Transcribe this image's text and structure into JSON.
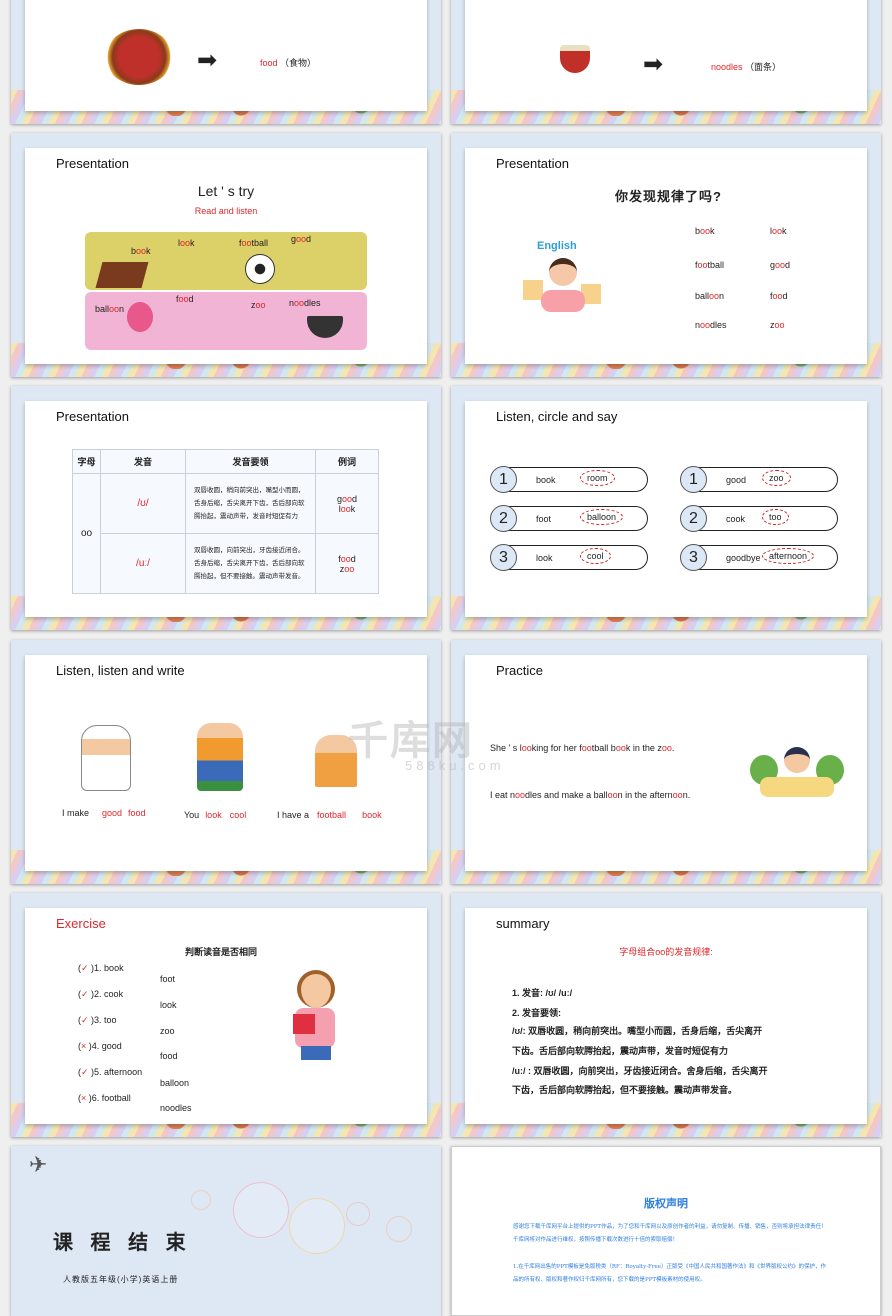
{
  "slide_food": {
    "word": "food",
    "cn": "（食物）",
    "image": "hotpot-image"
  },
  "slide_noodles": {
    "word": "noodles",
    "cn": "（面条）",
    "image": "noodle-bowl-image"
  },
  "slide_letstry": {
    "heading": "Presentation",
    "title": "Let ' s try",
    "subtitle": "Read and listen",
    "labels": [
      "book",
      "look",
      "football",
      "good",
      "balloon",
      "food",
      "zoo",
      "noodles"
    ]
  },
  "slide_rule": {
    "heading": "Presentation",
    "title": "你发现规律了吗?",
    "col1": [
      "book",
      "football",
      "balloon",
      "noodles"
    ],
    "col2": [
      "look",
      "good",
      "food",
      "zoo"
    ],
    "image_label": "English"
  },
  "slide_table": {
    "heading": "Presentation",
    "headers": [
      "字母",
      "发音",
      "发音要领",
      "例词"
    ],
    "letter": "oo",
    "rows": [
      {
        "sound": "/ʊ/",
        "tip": "双唇收圆，稍向前突出，嘴型小而圆，舌身后缩，舌尖离开下齿，舌后部向软腭抬起，震动声带，发音时短促有力",
        "ex1": "good",
        "ex2": "look"
      },
      {
        "sound": "/uː/",
        "tip": "双唇收圆，向前突出，牙齿接近闭合。舌身后缩，舌尖离开下齿，舌后部向软腭抬起，但不要接触。震动声带发音。",
        "ex1": "food",
        "ex2": "zoo"
      }
    ]
  },
  "slide_circle": {
    "heading": "Listen, circle and say",
    "left": [
      {
        "n": "1",
        "a": "book",
        "b": "room"
      },
      {
        "n": "2",
        "a": "foot",
        "b": "balloon"
      },
      {
        "n": "3",
        "a": "look",
        "b": "cool"
      }
    ],
    "right": [
      {
        "n": "1",
        "a": "good",
        "b": "zoo"
      },
      {
        "n": "2",
        "a": "cook",
        "b": "too"
      },
      {
        "n": "3",
        "a": "goodbye",
        "b": "afternoon"
      }
    ]
  },
  "slide_write": {
    "heading": "Listen, listen and write",
    "s1": {
      "pre": "I make",
      "a": "good",
      "b": "food"
    },
    "s2": {
      "pre": "You",
      "a": "look",
      "b": "cool"
    },
    "s3": {
      "pre": "I have a",
      "a": "football",
      "b": "book"
    }
  },
  "slide_practice": {
    "heading": "Practice",
    "s1": "She ' s looking for her football book in the zoo.",
    "s2": "I eat noodles and make a balloon in the afternoon."
  },
  "slide_exercise": {
    "heading": "Exercise",
    "title": "判断读音是否相同",
    "items": [
      {
        "mark": "✓",
        "a": "1. book",
        "b": "foot"
      },
      {
        "mark": "✓",
        "a": "2. cook",
        "b": "look"
      },
      {
        "mark": "✓",
        "a": "3. too",
        "b": "zoo"
      },
      {
        "mark": "×",
        "a": "4. good",
        "b": "food"
      },
      {
        "mark": "✓",
        "a": "5. afternoon",
        "b": "balloon"
      },
      {
        "mark": "×",
        "a": "6. football",
        "b": "noodles"
      }
    ]
  },
  "slide_summary": {
    "heading": "summary",
    "title": "字母组合oo的发音规律:",
    "lines": [
      "1. 发音:  /ʊ/   /uː/",
      "2. 发音要领:",
      " /ʊ/:  双唇收圆，稍向前突出。嘴型小而圆，舌身后缩，舌尖离开",
      "下齿。舌后部向软腭抬起，震动声带，发音时短促有力",
      " /uː/ : 双唇收圆，向前突出，牙齿接近闭合。舍身后缩，舌尖离开",
      "下齿，舌后部向软腭抬起，但不要接触。震动声带发音。"
    ]
  },
  "slide_end": {
    "title": "课 程 结 束",
    "subtitle": "人教版五年级(小学)英语上册"
  },
  "slide_copyright": {
    "title": "版权声明",
    "p1": "感谢您下载千库网平台上提供的PPT作品，为了您和千库网以及原创作者的利益，请勿复制、传播、销售，否则将承担法律责任！千库网将对作品进行维权，按照传播下载次数进行十倍的索取赔偿！",
    "p2": "1.在千库网出售的PPT模板是免版税类（RF：Royalty-Free）正版受《中国人民共和国著作法》和《世界版权公约》的保护，作品的所有权、版权和著作权归千库网所有，您下载的是PPT模板素材的使用权。"
  },
  "watermark": {
    "logo": "千库网",
    "url": "588ku.com"
  },
  "colors": {
    "accent_red": "#e0262a",
    "slide_bg": "#dde8f4",
    "copyright_blue": "#2f7fe0"
  }
}
